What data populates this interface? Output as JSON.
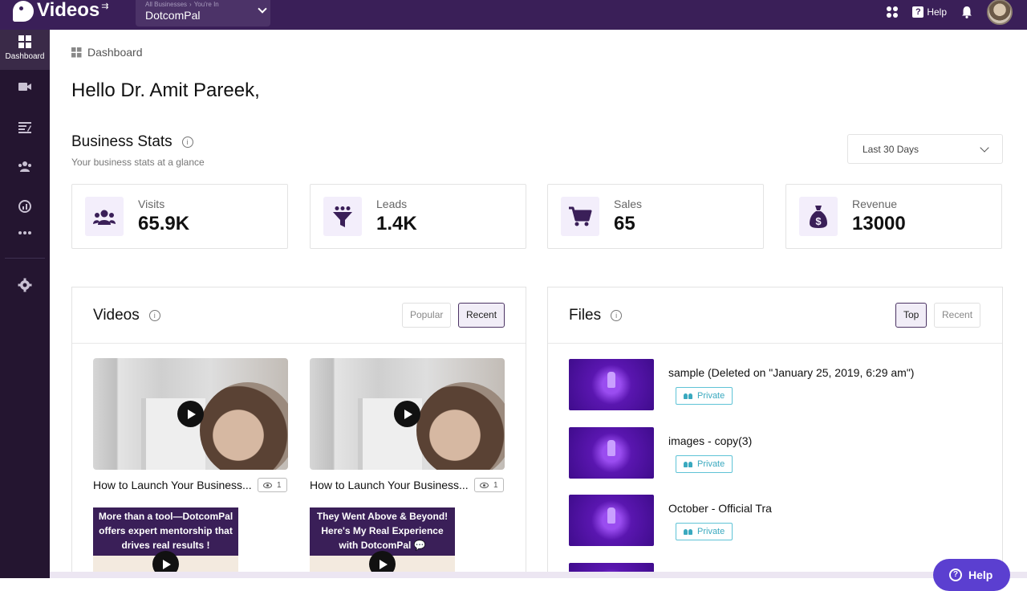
{
  "app": {
    "name": "Videos"
  },
  "business_switcher": {
    "crumb_parent": "All Businesses",
    "crumb_sep": "›",
    "crumb_current": "You're In",
    "name": "DotcomPal"
  },
  "topbar": {
    "help_label": "Help"
  },
  "sidebar": {
    "items": [
      {
        "label": "Dashboard",
        "icon": "dashboard-icon"
      },
      {
        "icon": "video-camera-icon"
      },
      {
        "icon": "content-list-icon"
      },
      {
        "icon": "people-icon"
      },
      {
        "icon": "analytics-icon"
      },
      {
        "icon": "more-dots-icon"
      },
      {
        "icon": "settings-gear-icon"
      }
    ]
  },
  "breadcrumb": {
    "label": "Dashboard"
  },
  "greeting": "Hello Dr. Amit Pareek,",
  "business_stats": {
    "title": "Business Stats",
    "subtitle": "Your business stats at a glance",
    "range": "Last 30 Days",
    "cards": [
      {
        "label": "Visits",
        "value": "65.9K",
        "icon": "people-icon"
      },
      {
        "label": "Leads",
        "value": "1.4K",
        "icon": "funnel-icon"
      },
      {
        "label": "Sales",
        "value": "65",
        "icon": "cart-icon"
      },
      {
        "label": "Revenue",
        "value": "13000",
        "icon": "money-bag-icon"
      }
    ]
  },
  "videos_panel": {
    "title": "Videos",
    "tabs": [
      {
        "label": "Popular",
        "active": false
      },
      {
        "label": "Recent",
        "active": true
      }
    ],
    "videos": [
      {
        "title": "How to Launch Your Business...",
        "views": "1"
      },
      {
        "title": "How to Launch Your Business...",
        "views": "1"
      },
      {
        "promo_text": "More than a tool—DotcomPal offers expert mentorship that drives real results !"
      },
      {
        "promo_text": "They Went Above & Beyond! Here's My Real Experience with DotcomPal 💬"
      }
    ]
  },
  "files_panel": {
    "title": "Files",
    "tabs": [
      {
        "label": "Top",
        "active": true
      },
      {
        "label": "Recent",
        "active": false
      }
    ],
    "files": [
      {
        "name": "sample (Deleted on \"January 25, 2019, 6:29 am\")",
        "visibility": "Private"
      },
      {
        "name": "images - copy(3)",
        "visibility": "Private"
      },
      {
        "name": "October - Official Tra",
        "visibility": "Private"
      }
    ]
  },
  "help_fab": {
    "label": "Help"
  },
  "colors": {
    "topbar": "#3a1f58",
    "sidebar": "#241530",
    "accent": "#4b3363",
    "private": "#3aa9bf"
  }
}
